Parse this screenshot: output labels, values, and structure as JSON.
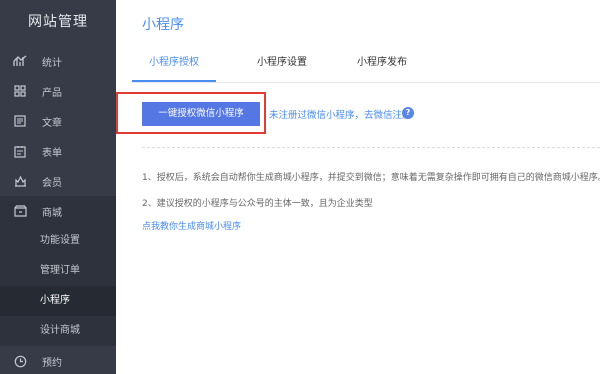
{
  "sidebar": {
    "title": "网站管理",
    "items": [
      {
        "label": "统计",
        "icon": "stats-icon"
      },
      {
        "label": "产品",
        "icon": "grid-icon"
      },
      {
        "label": "文章",
        "icon": "article-icon"
      },
      {
        "label": "表单",
        "icon": "form-icon"
      },
      {
        "label": "会员",
        "icon": "member-icon"
      },
      {
        "label": "商城",
        "icon": "shop-icon"
      }
    ],
    "sub_items": [
      {
        "label": "功能设置"
      },
      {
        "label": "管理订单"
      },
      {
        "label": "小程序"
      },
      {
        "label": "设计商城"
      }
    ],
    "last_item": {
      "label": "预约",
      "icon": "clock-icon"
    }
  },
  "main": {
    "title": "小程序",
    "tabs": [
      {
        "label": "小程序授权"
      },
      {
        "label": "小程序设置"
      },
      {
        "label": "小程序发布"
      }
    ],
    "auth_button": "一键授权微信小程序",
    "register_link": "未注册过微信小程序，去微信注册",
    "help_icon": "?",
    "notes": [
      "1、授权后，系统会自动帮你生成商城小程序，并提交到微信；意味着无需复杂操作即可拥有自己的微信商城小程序。",
      "2、建议授权的小程序与公众号的主体一致，且为企业类型"
    ],
    "guide_link": "点我教你生成商城小程序"
  },
  "colors": {
    "sidebar_bg": "#363b47",
    "accent": "#4a8df0",
    "button": "#5577e3",
    "highlight_border": "#e13b32"
  }
}
